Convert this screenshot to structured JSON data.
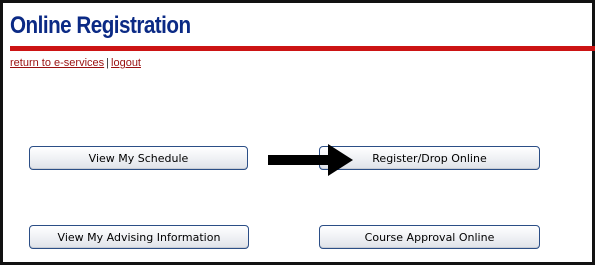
{
  "page": {
    "title": "Online Registration"
  },
  "nav": {
    "return_link": "return to e-services",
    "separator": "|",
    "logout_link": "logout"
  },
  "buttons": {
    "view_schedule": "View My Schedule",
    "register_drop": "Register/Drop Online",
    "view_advising": "View My Advising Information",
    "course_approval": "Course Approval Online"
  },
  "colors": {
    "title": "#0b2a85",
    "rule": "#cc1414",
    "link": "#9a0f0f",
    "button_border": "#2b4e86",
    "arrow": "#000000"
  },
  "icons": {
    "arrow": "right-arrow-icon"
  }
}
